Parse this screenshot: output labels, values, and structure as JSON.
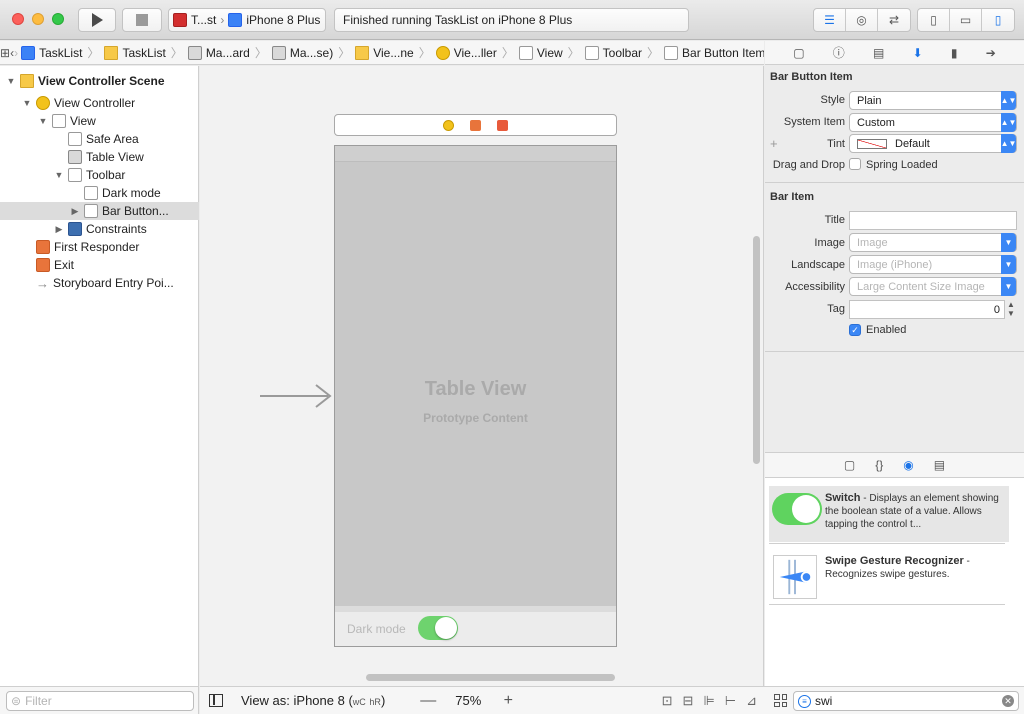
{
  "toolbar": {
    "scheme_target": "T...st",
    "scheme_device": "iPhone 8 Plus",
    "status": "Finished running TaskList on iPhone 8 Plus"
  },
  "jumpbar": {
    "crumbs": [
      "TaskList",
      "TaskList",
      "Ma...ard",
      "Ma...se)",
      "Vie...ne",
      "Vie...ller",
      "View",
      "Toolbar",
      "Bar Button Item"
    ]
  },
  "navigator": {
    "items": [
      {
        "label": "View Controller Scene",
        "icon": "scene-icon"
      },
      {
        "label": "View Controller",
        "icon": "view-controller-icon"
      },
      {
        "label": "View",
        "icon": "view-icon"
      },
      {
        "label": "Safe Area",
        "icon": "safe-area-icon"
      },
      {
        "label": "Table View",
        "icon": "table-view-icon"
      },
      {
        "label": "Toolbar",
        "icon": "toolbar-icon"
      },
      {
        "label": "Dark mode",
        "icon": "bar-button-item-icon"
      },
      {
        "label": "Bar Button...",
        "icon": "bar-button-item-icon"
      },
      {
        "label": "Constraints",
        "icon": "constraints-icon"
      },
      {
        "label": "First Responder",
        "icon": "first-responder-icon"
      },
      {
        "label": "Exit",
        "icon": "exit-icon"
      },
      {
        "label": "Storyboard Entry Poi...",
        "icon": "arrow-icon"
      }
    ],
    "filter_placeholder": "Filter"
  },
  "canvas": {
    "table_title": "Table View",
    "table_subtitle": "Prototype Content",
    "toolbar_label": "Dark mode",
    "view_as": "View as: iPhone 8",
    "size_class_w": "wC",
    "size_class_h": "hR",
    "zoom": "75%"
  },
  "inspector": {
    "bar_button_item": {
      "title": "Bar Button Item",
      "style_label": "Style",
      "style_value": "Plain",
      "system_item_label": "System Item",
      "system_item_value": "Custom",
      "tint_label": "Tint",
      "tint_value": "Default",
      "drag_drop_label": "Drag and Drop",
      "spring_loaded_label": "Spring Loaded"
    },
    "bar_item": {
      "title": "Bar Item",
      "title_label": "Title",
      "title_value": "",
      "image_label": "Image",
      "image_placeholder": "Image",
      "landscape_label": "Landscape",
      "landscape_placeholder": "Image (iPhone)",
      "accessibility_label": "Accessibility",
      "accessibility_placeholder": "Large Content Size Image",
      "tag_label": "Tag",
      "tag_value": "0",
      "enabled_label": "Enabled"
    }
  },
  "library": {
    "items": [
      {
        "name": "Switch",
        "description": "- Displays an element showing the boolean state of a value. Allows tapping the control t..."
      },
      {
        "name": "Swipe Gesture Recognizer",
        "description": "- Recognizes swipe gestures."
      }
    ],
    "search_value": "swi"
  },
  "colors": {
    "accent": "#1a73e8",
    "switch_on": "#5fd35f",
    "first_responder": "#e8743b"
  }
}
